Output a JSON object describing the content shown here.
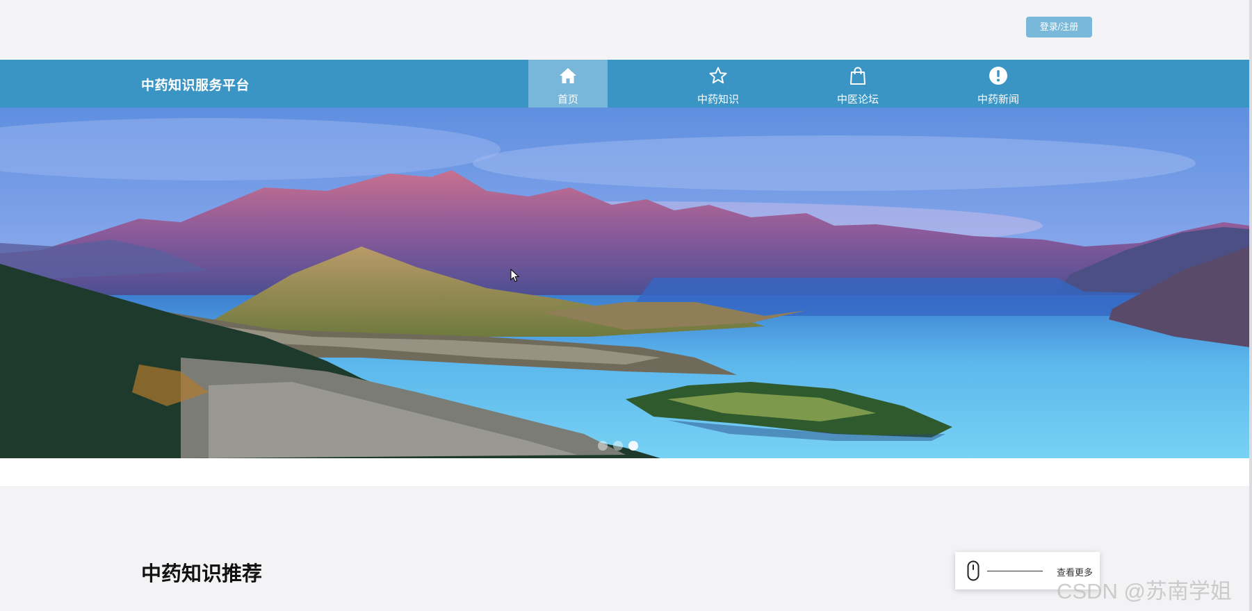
{
  "header": {
    "login_label": "登录/注册"
  },
  "nav": {
    "site_title": "中药知识服务平台",
    "items": [
      {
        "label": "首页",
        "icon": "home-icon",
        "active": true
      },
      {
        "label": "中药知识",
        "icon": "star-icon",
        "active": false
      },
      {
        "label": "中医论坛",
        "icon": "shopping-bag-icon",
        "active": false
      },
      {
        "label": "中药新闻",
        "icon": "exclamation-circle-icon",
        "active": false
      }
    ]
  },
  "banner": {
    "image": "mountain-lake-landscape",
    "slide_count": 3,
    "active_slide": 3
  },
  "section": {
    "title": "中药知识推荐",
    "more_label": "查看更多",
    "more_icon": "mouse-icon"
  },
  "watermark": "CSDN @苏南学姐",
  "colors": {
    "nav_bg": "#3a95c4",
    "nav_active": "#79b7da",
    "login_bg": "#7ab8da",
    "page_bg": "#f3f2f4"
  }
}
